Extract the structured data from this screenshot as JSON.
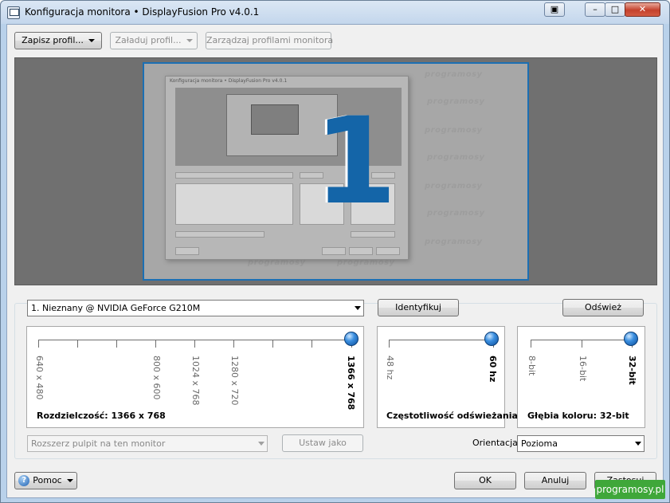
{
  "window": {
    "title": "Konfiguracja monitora • DisplayFusion Pro v4.0.1"
  },
  "toolbar": {
    "save_profile": "Zapisz profil...",
    "load_profile": "Załaduj profil...",
    "manage_profiles": "Zarządzaj profilami monitora"
  },
  "preview": {
    "monitor_number": "1",
    "watermark": "programosy"
  },
  "monitor_select": {
    "value": "1. Nieznany @ NVIDIA GeForce G210M"
  },
  "buttons": {
    "identify": "Identyfikuj",
    "refresh": "Odśwież",
    "set_as": "Ustaw jako",
    "help": "Pomoc",
    "ok": "OK",
    "cancel": "Anuluj",
    "apply": "Zastosuj"
  },
  "resolution": {
    "ticks": [
      "640 x 480",
      "800 x 600",
      "1024 x 768",
      "1280 x 720",
      "1366 x 768"
    ],
    "selected": "1366 x 768",
    "label": "Rozdzielczość: 1366 x 768"
  },
  "refresh_rate": {
    "ticks": [
      "48 hz",
      "60 hz"
    ],
    "selected": "60 hz",
    "label": "Częstotliwość odświeżania"
  },
  "color_depth": {
    "ticks": [
      "8-bit",
      "16-bit",
      "32-bit"
    ],
    "selected": "32-bit",
    "label": "Głębia koloru: 32-bit"
  },
  "desktop_combo": {
    "value": "Rozszerz pulpit na ten monitor"
  },
  "orientation": {
    "label": "Orientacja:",
    "value": "Pozioma"
  },
  "brand_badge": "programosy.pl",
  "colors": {
    "accent": "#1465a8",
    "knob": "#3b8fe0"
  }
}
